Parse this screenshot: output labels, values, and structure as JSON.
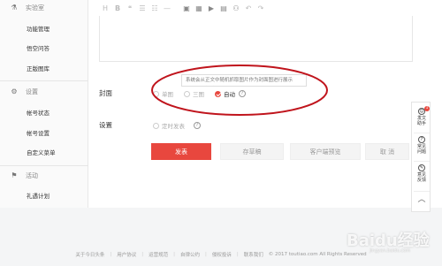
{
  "sidebar": {
    "groups": [
      {
        "label": "实验室",
        "icon": "beaker-icon",
        "items": [
          "功能管理",
          "悟空问答",
          "正版图库"
        ]
      },
      {
        "label": "设置",
        "icon": "gear-icon",
        "items": [
          "帐号状态",
          "帐号设置",
          "自定义菜单"
        ]
      },
      {
        "label": "活动",
        "icon": "flag-icon",
        "items": [
          "礼遇计划"
        ]
      }
    ]
  },
  "editor": {
    "toolbar_icons": [
      "H",
      "B",
      "❝",
      "☰",
      "☷",
      "—",
      "▣",
      "▦",
      "▶",
      "▤",
      "⚇",
      "↶",
      "↷"
    ]
  },
  "cover": {
    "label": "封面",
    "options": [
      "单图",
      "三图",
      "自动"
    ],
    "selected": "自动",
    "tooltip": "系统会从正文中随机抓取图片作为封面图进行展示"
  },
  "settings": {
    "label": "设置",
    "scheduled_label": "定时发表"
  },
  "actions": {
    "publish": "发表",
    "save_draft": "存草稿",
    "preview": "客户端预览",
    "cancel": "取 消"
  },
  "float_bar": {
    "badge": "1",
    "items": [
      "发文助手",
      "常见问题",
      "意见反馈"
    ]
  },
  "footer": {
    "links": [
      "关于今日头条",
      "用户协议",
      "运营规范",
      "自律公约",
      "侵权投诉",
      "联系我们"
    ],
    "copyright": "© 2017 toutiao.com All Rights Reserved"
  },
  "watermark": {
    "text": "Baidu经验",
    "sub": "jingyan.baidu.com"
  },
  "colors": {
    "accent": "#e8473e",
    "annotation": "#c0141c"
  }
}
